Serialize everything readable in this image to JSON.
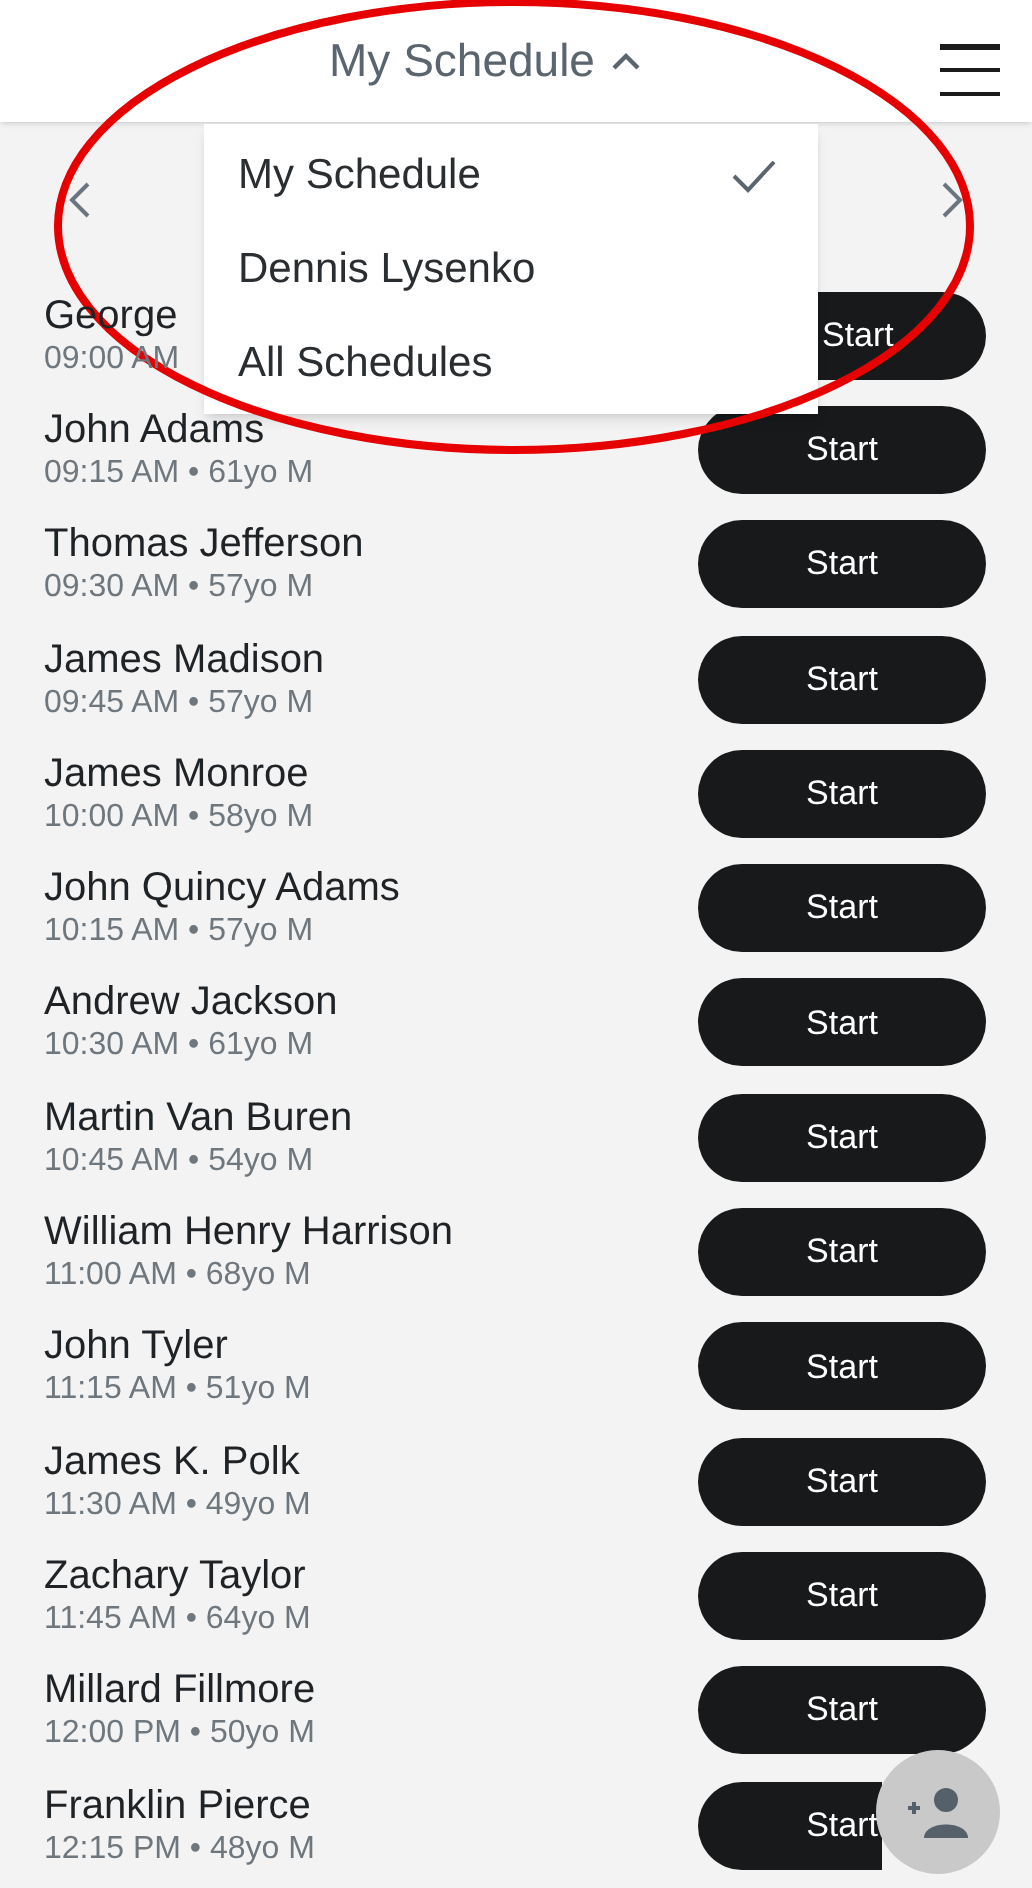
{
  "header": {
    "title": "My Schedule",
    "menu_open": true
  },
  "dropdown": {
    "items": [
      {
        "label": "My Schedule",
        "selected": true
      },
      {
        "label": "Dennis Lysenko",
        "selected": false
      },
      {
        "label": "All Schedules",
        "selected": false
      }
    ]
  },
  "appointments": [
    {
      "name": "George",
      "detail": "09:00 AM",
      "action": "Start"
    },
    {
      "name": "John Adams",
      "detail": "09:15 AM • 61yo M",
      "action": "Start"
    },
    {
      "name": "Thomas Jefferson",
      "detail": "09:30 AM • 57yo M",
      "action": "Start"
    },
    {
      "name": "James Madison",
      "detail": "09:45 AM • 57yo M",
      "action": "Start"
    },
    {
      "name": "James Monroe",
      "detail": "10:00 AM • 58yo M",
      "action": "Start"
    },
    {
      "name": "John Quincy Adams",
      "detail": "10:15 AM • 57yo M",
      "action": "Start"
    },
    {
      "name": "Andrew Jackson",
      "detail": "10:30 AM • 61yo M",
      "action": "Start"
    },
    {
      "name": "Martin Van Buren",
      "detail": "10:45 AM • 54yo M",
      "action": "Start"
    },
    {
      "name": "William Henry Harrison",
      "detail": "11:00 AM • 68yo M",
      "action": "Start"
    },
    {
      "name": "John Tyler",
      "detail": "11:15 AM • 51yo M",
      "action": "Start"
    },
    {
      "name": "James K. Polk",
      "detail": "11:30 AM • 49yo M",
      "action": "Start"
    },
    {
      "name": "Zachary Taylor",
      "detail": "11:45 AM • 64yo M",
      "action": "Start"
    },
    {
      "name": "Millard Fillmore",
      "detail": "12:00 PM • 50yo M",
      "action": "Start"
    },
    {
      "name": "Franklin Pierce",
      "detail": "12:15 PM • 48yo M",
      "action": "Start"
    }
  ]
}
